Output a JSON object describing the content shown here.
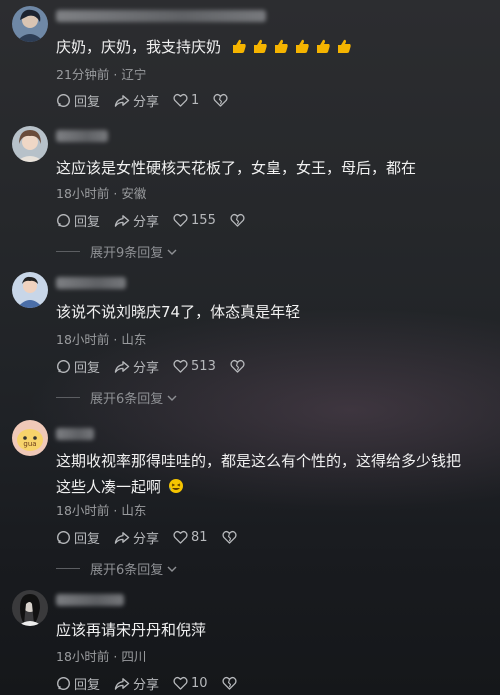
{
  "comments": [
    {
      "text": "庆奶，庆奶，我支持庆奶",
      "thumb_emoji_count": 6,
      "time": "21分钟前",
      "location": "辽宁",
      "reply_label": "回复",
      "share_label": "分享",
      "likes": "1"
    },
    {
      "text": "这应该是女性硬核天花板了，女皇，女王，母后，都在",
      "time": "18小时前",
      "location": "安徽",
      "reply_label": "回复",
      "share_label": "分享",
      "likes": "155",
      "expand_label": "展开9条回复"
    },
    {
      "text": "该说不说刘晓庆74了，体态真是年轻",
      "time": "18小时前",
      "location": "山东",
      "reply_label": "回复",
      "share_label": "分享",
      "likes": "513",
      "expand_label": "展开6条回复"
    },
    {
      "text_line1": "这期收视率那得哇哇的，都是这么有个性的，这得给多少钱把",
      "text_line2": "这些人凑一起啊",
      "time": "18小时前",
      "location": "山东",
      "reply_label": "回复",
      "share_label": "分享",
      "likes": "81",
      "expand_label": "展开6条回复"
    },
    {
      "text": "应该再请宋丹丹和倪萍",
      "time": "18小时前",
      "location": "四川",
      "reply_label": "回复",
      "share_label": "分享",
      "likes": "10"
    }
  ],
  "colors": {
    "accent_thumb": "#f5b400",
    "meta_gray": "#9a9c9f"
  },
  "icons": [
    "reply-icon",
    "share-icon",
    "heart-icon",
    "dislike-icon",
    "chevron-down-icon",
    "thumbs-up-emoji",
    "laughing-emoji"
  ]
}
